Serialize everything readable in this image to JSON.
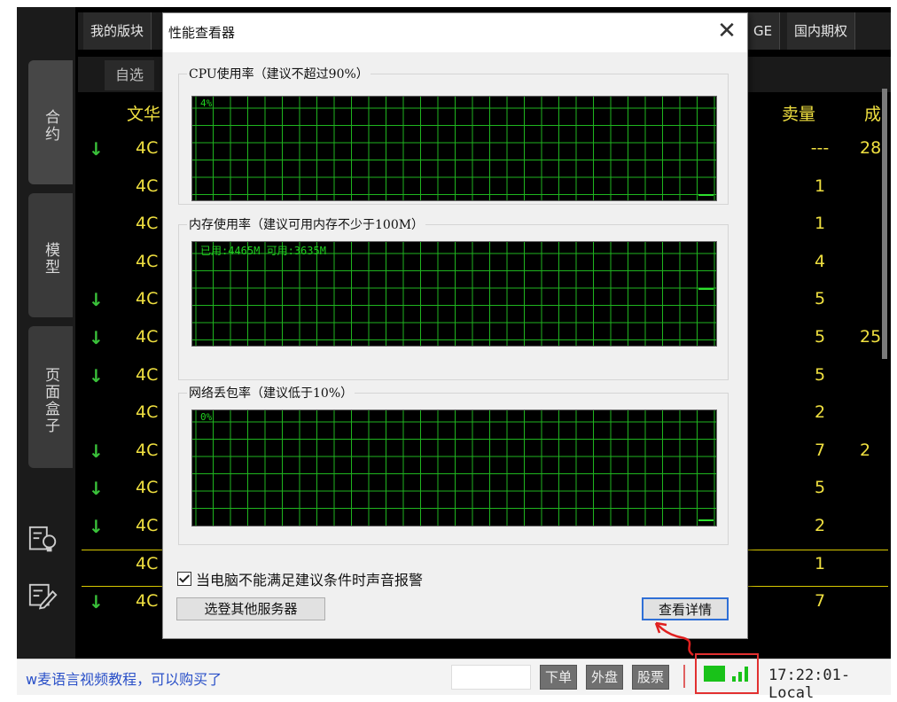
{
  "app": {
    "top_tabs": [
      "我的版块",
      "GE",
      "国内期权"
    ],
    "sub_tab": "自选",
    "side_tabs": [
      "合约",
      "模型",
      "页面盒子"
    ],
    "columns": {
      "name": "文华",
      "sell": "卖量",
      "deal": "成"
    },
    "rows": [
      {
        "arrow": "↓",
        "code": "4C",
        "sell": "---",
        "deal": "28"
      },
      {
        "arrow": "",
        "code": "4C",
        "sell": "1",
        "deal": ""
      },
      {
        "arrow": "",
        "code": "4C",
        "sell": "1",
        "deal": ""
      },
      {
        "arrow": "",
        "code": "4C",
        "sell": "4",
        "deal": ""
      },
      {
        "arrow": "↓",
        "code": "4C",
        "sell": "5",
        "deal": ""
      },
      {
        "arrow": "↓",
        "code": "4C",
        "sell": "5",
        "deal": "25"
      },
      {
        "arrow": "↓",
        "code": "4C",
        "sell": "5",
        "deal": ""
      },
      {
        "arrow": "",
        "code": "4C",
        "sell": "2",
        "deal": ""
      },
      {
        "arrow": "↓",
        "code": "4C",
        "sell": "7",
        "deal": "2"
      },
      {
        "arrow": "↓",
        "code": "4C",
        "sell": "5",
        "deal": ""
      },
      {
        "arrow": "↓",
        "code": "4C",
        "sell": "2",
        "deal": ""
      },
      {
        "arrow": "",
        "code": "4C",
        "sell": "1",
        "deal": ""
      },
      {
        "arrow": "↓",
        "code": "4C",
        "sell": "7",
        "deal": ""
      }
    ],
    "side_icons": [
      "lightbulb-doc-icon",
      "edit-doc-icon"
    ]
  },
  "status_bar": {
    "ticker": "w麦语言视频教程，可以购买了",
    "buttons": [
      "下单",
      "外盘",
      "股票"
    ],
    "clock": "17:22:01-Local",
    "signal_icon": "signal-strength-icon"
  },
  "dialog": {
    "title": "性能查看器",
    "close_icon": "close-icon",
    "cpu": {
      "label": "CPU使用率（建议不超过90%）",
      "value_text": "4%"
    },
    "memory": {
      "label": "内存使用率（建议可用内存不少于100M）",
      "value_text": "已用:4465M 可用:3635M"
    },
    "network": {
      "label": "网络丢包率（建议低于10%）",
      "value_text": "0%"
    },
    "alarm_checkbox": {
      "label": "当电脑不能满足建议条件时声音报警",
      "checked": true
    },
    "select_server_button": "选登其他服务器",
    "details_button": "查看详情",
    "colors": {
      "graph_bg": "#000000",
      "grid": "#1fb51f",
      "trace": "#2ee02e"
    }
  }
}
